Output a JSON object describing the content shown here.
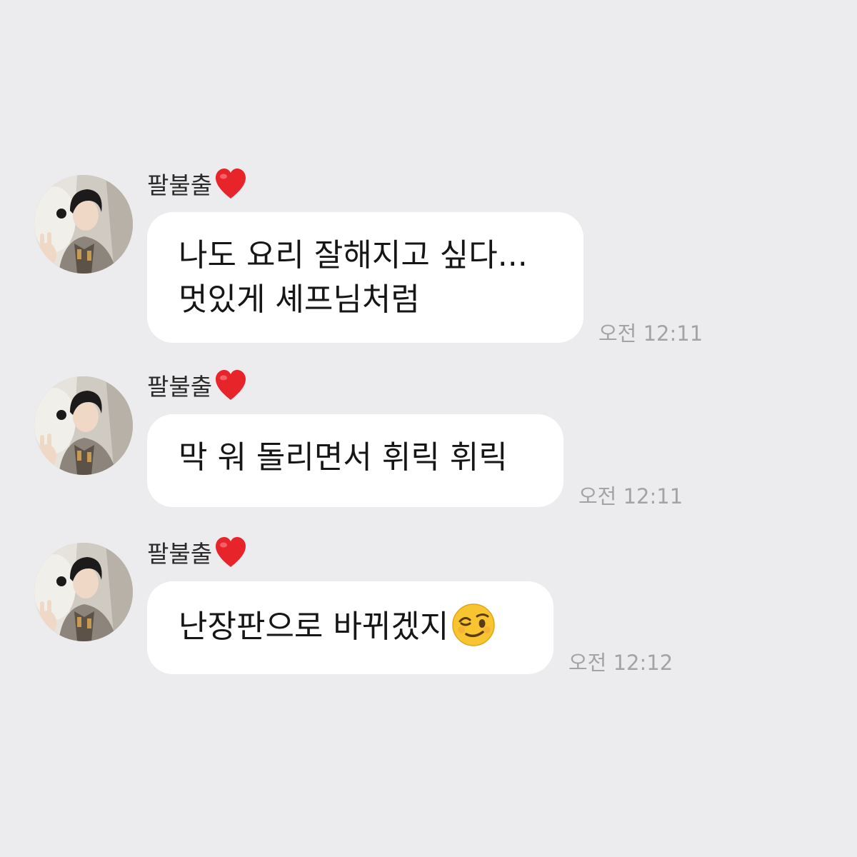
{
  "chat": {
    "messages": [
      {
        "sender": "팔불출",
        "lines": [
          "나도 요리 잘해지고 싶다...",
          "멋있게 셰프님처럼"
        ],
        "time": "오전 12:11"
      },
      {
        "sender": "팔불출",
        "lines": [
          "막 워 돌리면서 휘릭 휘릭"
        ],
        "time": "오전 12:11"
      },
      {
        "sender": "팔불출",
        "lines": [
          "난장판으로 바뀌겠지"
        ],
        "time": "오전 12:12"
      }
    ]
  },
  "icons": {
    "sender_badge": "red-heart-emoji",
    "message_emoji": "winking-face-emoji"
  },
  "colors": {
    "background": "#ececee",
    "bubble": "#ffffff",
    "text": "#161616",
    "time": "#a3a3a6",
    "heart": "#e8242b"
  }
}
